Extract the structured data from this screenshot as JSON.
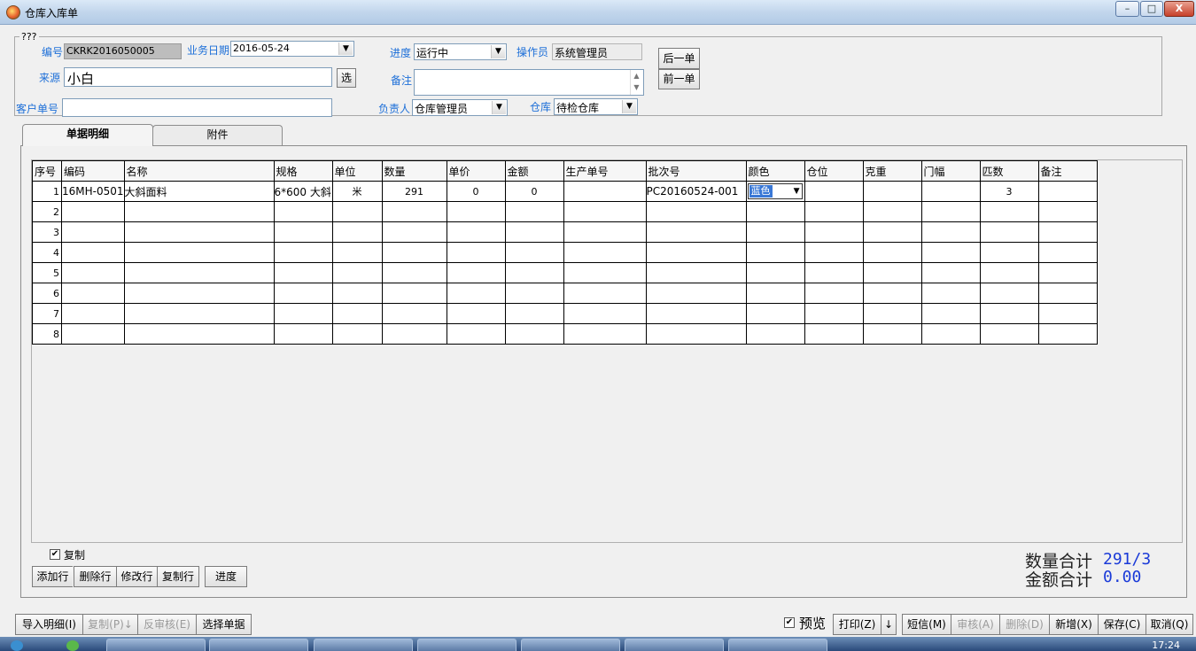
{
  "window": {
    "title": "仓库入库单",
    "controls": {
      "minimize": "–",
      "maximize": "□",
      "close": "X"
    }
  },
  "header": {
    "legend": "???",
    "labels": {
      "code": "编号",
      "biz_date": "业务日期",
      "progress": "进度",
      "operator": "操作员",
      "source": "来源",
      "remark": "备注",
      "customer_no": "客户单号",
      "owner": "负责人",
      "warehouse": "仓库"
    },
    "values": {
      "code": "CKRK2016050005",
      "biz_date": "2016-05-24",
      "progress": "运行中",
      "operator": "系统管理员",
      "source": "小白",
      "remark": "",
      "customer_no": "",
      "owner": "仓库管理员",
      "warehouse": "待检仓库"
    },
    "buttons": {
      "select": "选",
      "next": "后一单",
      "prev": "前一单"
    }
  },
  "tabs": [
    "单据明细",
    "附件"
  ],
  "grid": {
    "columns": [
      "序号",
      "编码",
      "名称",
      "规格",
      "单位",
      "数量",
      "单价",
      "金额",
      "生产单号",
      "批次号",
      "颜色",
      "仓位",
      "克重",
      "门幅",
      "匹数",
      "备注"
    ],
    "rows": [
      [
        "1",
        "16MH-0501",
        "大斜面料",
        "6*600 大斜",
        "米",
        "291",
        "0",
        "0",
        "",
        "PC20160524-001",
        "蓝色",
        "",
        "",
        "",
        "3",
        ""
      ],
      [
        "2",
        "",
        "",
        "",
        "",
        "",
        "",
        "",
        "",
        "",
        "",
        "",
        "",
        "",
        "",
        ""
      ],
      [
        "3",
        "",
        "",
        "",
        "",
        "",
        "",
        "",
        "",
        "",
        "",
        "",
        "",
        "",
        "",
        ""
      ],
      [
        "4",
        "",
        "",
        "",
        "",
        "",
        "",
        "",
        "",
        "",
        "",
        "",
        "",
        "",
        "",
        ""
      ],
      [
        "5",
        "",
        "",
        "",
        "",
        "",
        "",
        "",
        "",
        "",
        "",
        "",
        "",
        "",
        "",
        ""
      ],
      [
        "6",
        "",
        "",
        "",
        "",
        "",
        "",
        "",
        "",
        "",
        "",
        "",
        "",
        "",
        "",
        ""
      ],
      [
        "7",
        "",
        "",
        "",
        "",
        "",
        "",
        "",
        "",
        "",
        "",
        "",
        "",
        "",
        "",
        ""
      ],
      [
        "8",
        "",
        "",
        "",
        "",
        "",
        "",
        "",
        "",
        "",
        "",
        "",
        "",
        "",
        "",
        ""
      ]
    ]
  },
  "detail_actions": {
    "copy_checkbox": "复制",
    "copy_checked": true,
    "buttons": [
      "添加行",
      "删除行",
      "修改行",
      "复制行",
      "进度"
    ]
  },
  "totals": {
    "qty_label": "数量合计",
    "qty_value": "291/3",
    "amount_label": "金额合计",
    "amount_value": "0.00"
  },
  "footer": {
    "left_buttons": [
      "导入明细(I)",
      "复制(P)↓",
      "反审核(E)",
      "选择单据"
    ],
    "preview_label": "预览",
    "preview_checked": true,
    "right_buttons": [
      "打印(Z)",
      "↓",
      "短信(M)",
      "审核(A)",
      "删除(D)",
      "新增(X)",
      "保存(C)",
      "取消(Q)"
    ]
  },
  "taskbar": {
    "clock": "17:24"
  }
}
